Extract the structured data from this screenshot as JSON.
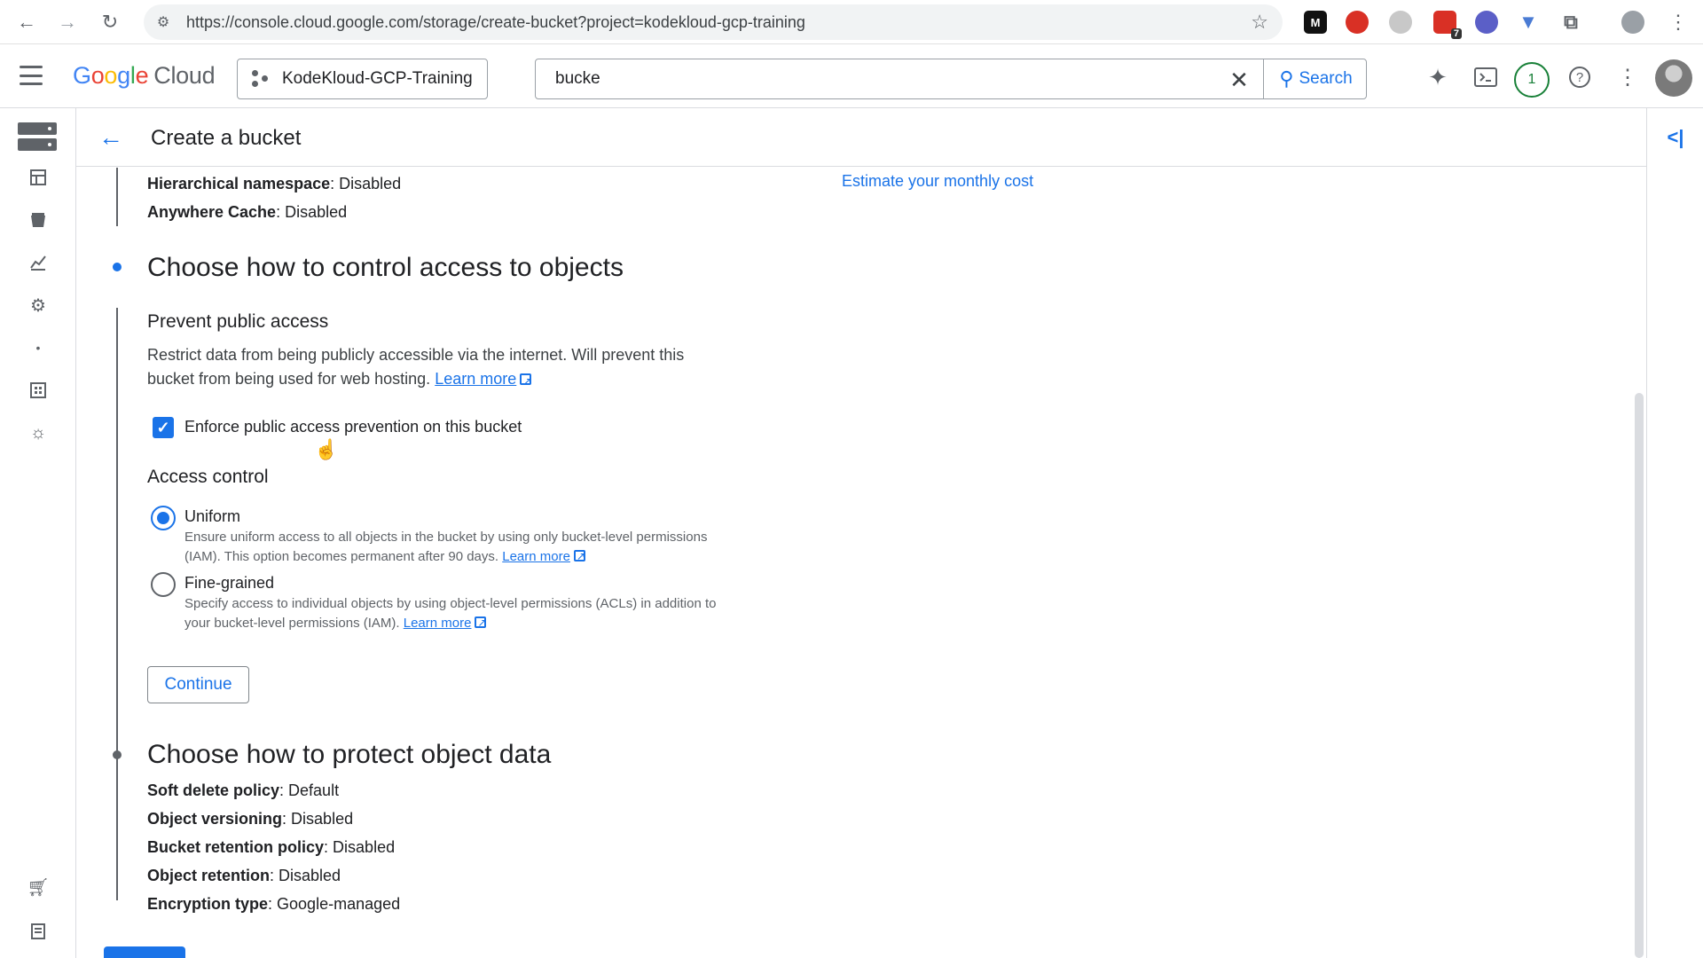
{
  "browser": {
    "url": "https://console.cloud.google.com/storage/create-bucket?project=kodekloud-gcp-training",
    "extensions": [
      {
        "name": "M",
        "color": "#111111"
      },
      {
        "name": "",
        "color": "#d93025"
      },
      {
        "name": "",
        "color": "#9aa0a6"
      },
      {
        "name": "",
        "color": "#d93025",
        "badge": "7"
      },
      {
        "name": "",
        "color": "#5b5fc7"
      },
      {
        "name": "",
        "color": "#4a7bd4"
      }
    ]
  },
  "header": {
    "logo_google": "Google",
    "logo_cloud": "Cloud",
    "project": "KodeKloud-GCP-Training",
    "search_value": "bucke",
    "search_button": "Search",
    "notification_count": "1"
  },
  "page": {
    "title": "Create a bucket"
  },
  "content": {
    "estimate_link": "Estimate your monthly cost",
    "prev_summary": [
      {
        "label": "Hierarchical namespace",
        "value": ": Disabled"
      },
      {
        "label": "Anywhere Cache",
        "value": ": Disabled"
      }
    ],
    "access_section": {
      "title": "Choose how to control access to objects",
      "prevent": {
        "heading": "Prevent public access",
        "description": "Restrict data from being publicly accessible via the internet. Will prevent this bucket from being used for web hosting.",
        "learn_more": "Learn more",
        "checkbox_label": "Enforce public access prevention on this bucket",
        "checked": true
      },
      "access_control": {
        "heading": "Access control",
        "options": [
          {
            "label": "Uniform",
            "description": "Ensure uniform access to all objects in the bucket by using only bucket-level permissions (IAM). This option becomes permanent after 90 days.",
            "learn_more": "Learn more",
            "selected": true
          },
          {
            "label": "Fine-grained",
            "description": "Specify access to individual objects by using object-level permissions (ACLs) in addition to your bucket-level permissions (IAM).",
            "learn_more": "Learn more",
            "selected": false
          }
        ]
      },
      "continue_button": "Continue"
    },
    "protect_section": {
      "title": "Choose how to protect object data",
      "summary": [
        {
          "label": "Soft delete policy",
          "value": ": Default"
        },
        {
          "label": "Object versioning",
          "value": ": Disabled"
        },
        {
          "label": "Bucket retention policy",
          "value": ": Disabled"
        },
        {
          "label": "Object retention",
          "value": ": Disabled"
        },
        {
          "label": "Encryption type",
          "value": ": Google-managed"
        }
      ]
    }
  },
  "colors": {
    "accent": "#1a73e8",
    "text": "#202124",
    "muted": "#5f6368",
    "notification": "#188038"
  }
}
